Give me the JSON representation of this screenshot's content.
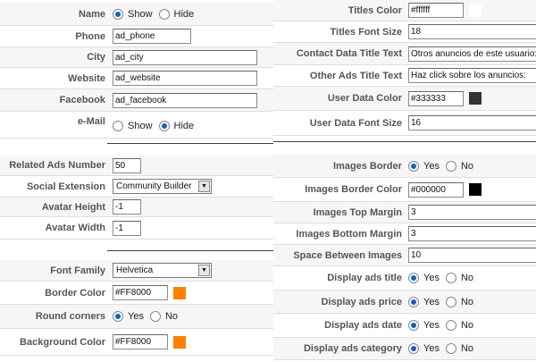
{
  "left": {
    "name": {
      "label": "Name",
      "show": "Show",
      "hide": "Hide",
      "selected": "Show"
    },
    "phone": {
      "label": "Phone",
      "value": "ad_phone"
    },
    "city": {
      "label": "City",
      "value": "ad_city"
    },
    "website": {
      "label": "Website",
      "value": "ad_website"
    },
    "facebook": {
      "label": "Facebook",
      "value": "ad_facebook"
    },
    "email": {
      "label": "e-Mail",
      "show": "Show",
      "hide": "Hide",
      "selected": "Hide"
    },
    "related_ads": {
      "label": "Related Ads Number",
      "value": "50"
    },
    "social": {
      "label": "Social Extension",
      "value": "Community Builder"
    },
    "avatar_height": {
      "label": "Avatar Height",
      "value": "-1"
    },
    "avatar_width": {
      "label": "Avatar Width",
      "value": "-1"
    },
    "font_family": {
      "label": "Font Family",
      "value": "Helvetica"
    },
    "border_color": {
      "label": "Border Color",
      "value": "#FF8000",
      "swatch": "#FF8000"
    },
    "round_corners": {
      "label": "Round corners",
      "yes": "Yes",
      "no": "No",
      "selected": "Yes"
    },
    "background_color": {
      "label": "Background Color",
      "value": "#FF8000",
      "swatch": "#FF8000"
    }
  },
  "right": {
    "titles_color": {
      "label": "Titles Color",
      "value": "#ffffff",
      "swatch": "#ffffff"
    },
    "titles_font_size": {
      "label": "Titles Font Size",
      "value": "18"
    },
    "contact_title": {
      "label": "Contact Data Title Text",
      "value": "Otros anuncios de este usuario:"
    },
    "other_ads_title": {
      "label": "Other Ads Title Text",
      "value": "Haz click sobre los anuncios:"
    },
    "user_data_color": {
      "label": "User Data Color",
      "value": "#333333",
      "swatch": "#333333"
    },
    "user_data_font_size": {
      "label": "User Data Font Size",
      "value": "16"
    },
    "images_border": {
      "label": "Images Border",
      "yes": "Yes",
      "no": "No",
      "selected": "Yes"
    },
    "images_border_color": {
      "label": "Images Border Color",
      "value": "#000000",
      "swatch": "#000000"
    },
    "images_top_margin": {
      "label": "Images Top Margin",
      "value": "3"
    },
    "images_bottom_margin": {
      "label": "Images Bottom Margin",
      "value": "3"
    },
    "space_between_images": {
      "label": "Space Between Images",
      "value": "10"
    },
    "display_title": {
      "label": "Display ads title",
      "yes": "Yes",
      "no": "No",
      "selected": "Yes"
    },
    "display_price": {
      "label": "Display ads price",
      "yes": "Yes",
      "no": "No",
      "selected": "Yes"
    },
    "display_date": {
      "label": "Display ads date",
      "yes": "Yes",
      "no": "No",
      "selected": "Yes"
    },
    "display_category": {
      "label": "Display ads category",
      "yes": "Yes",
      "no": "No",
      "selected": "Yes"
    }
  }
}
